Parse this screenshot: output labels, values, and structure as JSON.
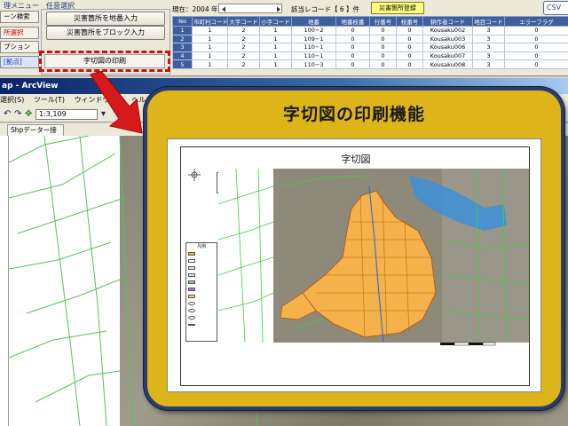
{
  "app": {
    "group1_title": "理メニュー",
    "group2_title": "任意選択",
    "menu_items": [
      {
        "label": "ーン検索",
        "color": "normal"
      },
      {
        "label": "所選択",
        "color": "red"
      },
      {
        "label": "プション",
        "color": "normal"
      },
      {
        "label": "[拠点]",
        "color": "blue"
      }
    ],
    "buttons": {
      "chiban_input": "災害箇所を地番入力",
      "block_input": "災害箇所をブロック入力",
      "print": "字切図の印刷"
    }
  },
  "records": {
    "year_text": "現在：2004 年",
    "count_text": "該当レコード【 6 】件",
    "register_button": "災害箇所登録",
    "csv_button": "CSV",
    "columns": [
      "No",
      "市町村コード",
      "大字コード",
      "小字コード",
      "地番",
      "地番枝番",
      "行番号",
      "枝番号",
      "耕作者コード",
      "地目コード",
      "エラーフラグ"
    ],
    "rows": [
      [
        "1",
        "1",
        "2",
        "1",
        "100−2",
        "0",
        "0",
        "0",
        "Kousaku002",
        "3",
        "0"
      ],
      [
        "2",
        "1",
        "2",
        "1",
        "109−1",
        "0",
        "0",
        "0",
        "Kousaku003",
        "3",
        "0"
      ],
      [
        "3",
        "1",
        "2",
        "1",
        "110−1",
        "0",
        "0",
        "0",
        "Kousaku006",
        "3",
        "0"
      ],
      [
        "4",
        "1",
        "2",
        "1",
        "110−1",
        "0",
        "0",
        "0",
        "Kousaku007",
        "3",
        "0"
      ],
      [
        "5",
        "1",
        "2",
        "1",
        "110−3",
        "0",
        "0",
        "0",
        "Kousaku008",
        "3",
        "0"
      ]
    ]
  },
  "arcview": {
    "title": "ap - ArcView",
    "menu": [
      "選択(S)",
      "ツール(T)",
      "ウィンドウ(W)",
      "ヘルプ"
    ],
    "scale": "1:3,109",
    "tab": "Shpデーター接設定"
  },
  "callout": {
    "heading": "字切図の印刷機能",
    "sheet_title": "字切図",
    "legend_title": "凡例"
  },
  "colors": {
    "callout_bg": "#ddb51a",
    "callout_border": "#2c3c6c",
    "highlight_parcel": "#f5b14a",
    "dash_outline": "#c81414",
    "grid_header": "#3e5f9e"
  }
}
